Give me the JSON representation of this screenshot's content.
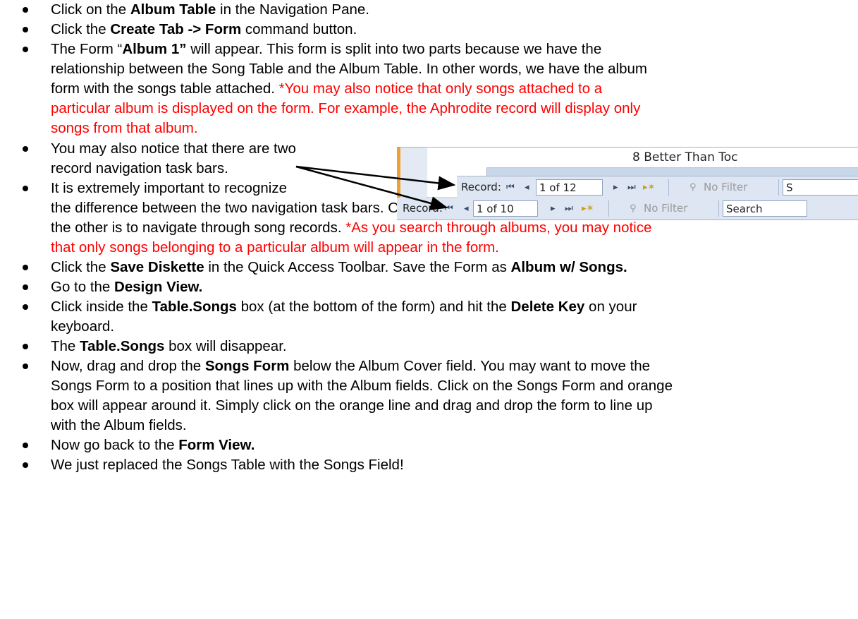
{
  "bullets": [
    {
      "parts": [
        {
          "t": "Click on the "
        },
        {
          "t": "Album Table",
          "b": true
        },
        {
          "t": " in the Navigation Pane."
        }
      ]
    },
    {
      "parts": [
        {
          "t": "Click the "
        },
        {
          "t": "Create Tab -> Form",
          "b": true
        },
        {
          "t": " command button."
        }
      ]
    },
    {
      "lines": [
        [
          {
            "t": "The Form “"
          },
          {
            "t": "Album 1”",
            "b": true
          },
          {
            "t": " will appear. This form is split into two parts because we have the"
          }
        ],
        [
          {
            "t": "relationship between the Song Table and the Album Table. In other words, we have the album"
          }
        ],
        [
          {
            "t": "form with the songs table attached. "
          },
          {
            "t": "*You may also notice that only songs attached to a",
            "red": true
          }
        ],
        [
          {
            "t": "particular album is displayed on the form. For example, the Aphrodite record will display only",
            "red": true
          }
        ],
        [
          {
            "t": "songs from that album.",
            "red": true
          }
        ]
      ]
    },
    {
      "lines": [
        [
          {
            "t": "You may also notice that there are two"
          }
        ],
        [
          {
            "t": "record navigation task bars."
          }
        ]
      ]
    },
    {
      "lines": [
        [
          {
            "t": "It is extremely important to recognize"
          }
        ],
        [
          {
            "t": "the difference between the two navigation task bars. One is navigate through the album records"
          }
        ],
        [
          {
            "t": "the other is to navigate through song records. "
          },
          {
            "t": "*As you search through albums, you may notice",
            "red": true
          }
        ],
        [
          {
            "t": "that only songs belonging to a particular album will appear in the form.",
            "red": true
          }
        ]
      ]
    },
    {
      "parts": [
        {
          "t": "Click the "
        },
        {
          "t": "Save Diskette",
          "b": true
        },
        {
          "t": " in the Quick Access Toolbar. Save the Form as "
        },
        {
          "t": "Album w/ Songs.",
          "b": true
        }
      ]
    },
    {
      "parts": [
        {
          "t": "Go to the "
        },
        {
          "t": "Design View.",
          "b": true
        }
      ]
    },
    {
      "lines": [
        [
          {
            "t": "Click inside the "
          },
          {
            "t": "Table.Songs",
            "b": true
          },
          {
            "t": " box (at the bottom of the form) and hit the "
          },
          {
            "t": "Delete Key",
            "b": true
          },
          {
            "t": " on your"
          }
        ],
        [
          {
            "t": "keyboard."
          }
        ]
      ]
    },
    {
      "parts": [
        {
          "t": "The "
        },
        {
          "t": "Table.Songs",
          "b": true
        },
        {
          "t": " box will disappear."
        }
      ]
    },
    {
      "lines": [
        [
          {
            "t": "Now, drag and drop the "
          },
          {
            "t": "Songs Form",
            "b": true
          },
          {
            "t": " below the Album Cover field. You may want to move the"
          }
        ],
        [
          {
            "t": "Songs Form to a position that lines up with the Album fields. Click on the Songs Form and orange"
          }
        ],
        [
          {
            "t": "box will appear around it. Simply click on the orange line and drag and drop the form to line up"
          }
        ],
        [
          {
            "t": "with the Album fields."
          }
        ]
      ]
    },
    {
      "parts": [
        {
          "t": "Now go back to the "
        },
        {
          "t": "Form View.",
          "b": true
        }
      ]
    },
    {
      "parts": [
        {
          "t": "We just replaced the Songs Table with the Songs Field!"
        }
      ]
    }
  ],
  "inset": {
    "song_row": "8 Better Than Toc",
    "album_nav": {
      "label": "Record:",
      "position": "1 of 12",
      "filter": "No Filter",
      "search": "S"
    },
    "song_nav": {
      "label": "Record:",
      "position": "1 of 10",
      "filter": "No Filter",
      "search": "Search"
    },
    "icons": [
      "first-record-icon",
      "previous-record-icon",
      "next-record-icon",
      "last-record-icon",
      "new-record-icon",
      "filter-icon"
    ]
  },
  "colors": {
    "text": "#000000",
    "note": "#ff0000",
    "access_blue": "#c9d7ea",
    "orange": "#f0a030"
  }
}
